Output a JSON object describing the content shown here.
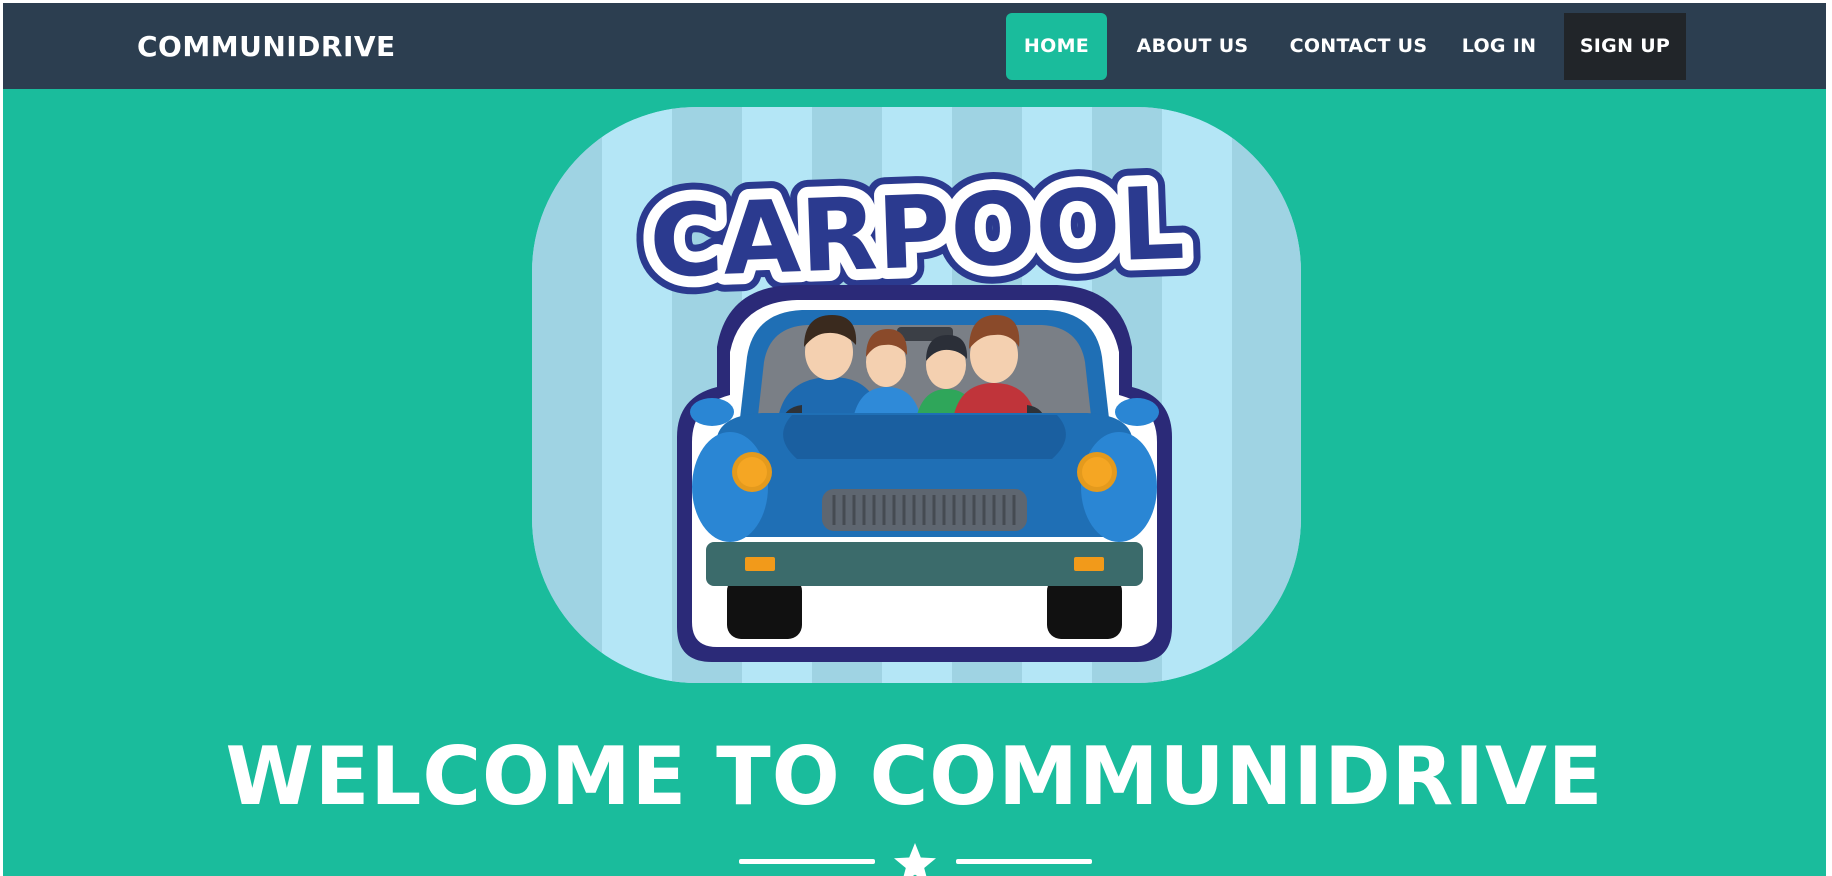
{
  "navbar": {
    "brand": "COMMUNIDRIVE",
    "links": {
      "home": "HOME",
      "about": "ABOUT US",
      "contact": "CONTACT US",
      "login": "LOG IN",
      "signup": "SIGN UP"
    },
    "active": "home"
  },
  "hero": {
    "image_text": "CARPOOL",
    "heading": "WELCOME TO COMMUNIDRIVE",
    "divider_icon": "star-icon"
  },
  "colors": {
    "primary": "#1abc9c",
    "navbar_bg": "#2c3e50",
    "signup_bg": "#212529",
    "text_light": "#ffffff"
  }
}
